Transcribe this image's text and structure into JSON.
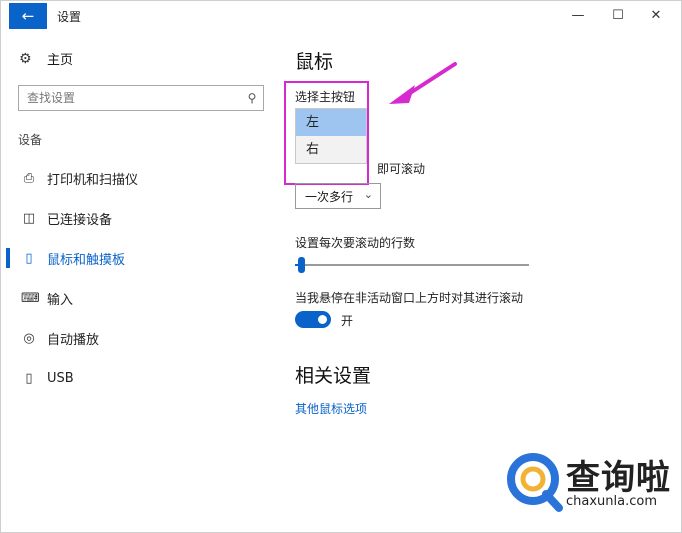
{
  "window": {
    "title": "设置",
    "back_icon": "back-arrow-icon",
    "controls": {
      "minimize": "—",
      "maximize": "☐",
      "close": "✕"
    }
  },
  "sidebar": {
    "home_label": "主页",
    "search_placeholder": "查找设置",
    "section_label": "设备",
    "items": [
      {
        "label": "打印机和扫描仪",
        "icon": "printer-icon"
      },
      {
        "label": "已连接设备",
        "icon": "connected-devices-icon"
      },
      {
        "label": "鼠标和触摸板",
        "icon": "mouse-icon",
        "active": true
      },
      {
        "label": "输入",
        "icon": "keyboard-icon"
      },
      {
        "label": "自动播放",
        "icon": "autoplay-icon"
      },
      {
        "label": "USB",
        "icon": "usb-icon"
      }
    ]
  },
  "main": {
    "title": "鼠标",
    "primary_button_label": "选择主按钮",
    "primary_button_options": [
      "左",
      "右"
    ],
    "primary_button_selected": "左",
    "scroll_label_partial": "即可滚动",
    "scroll_select_value": "一次多行",
    "lines_label": "设置每次要滚动的行数",
    "lines_value_fraction": 0.0,
    "hover_scroll_label": "当我悬停在非活动窗口上方时对其进行滚动",
    "hover_scroll_state": "开",
    "related_title": "相关设置",
    "related_link": "其他鼠标选项"
  },
  "annotation": {
    "box_color": "#d629d0",
    "arrow_color": "#d629d0"
  },
  "watermark": {
    "name": "查询啦",
    "domain": "chaxunla.com"
  },
  "colors": {
    "accent": "#0a63c9",
    "selected_option": "#9ec5f0"
  }
}
